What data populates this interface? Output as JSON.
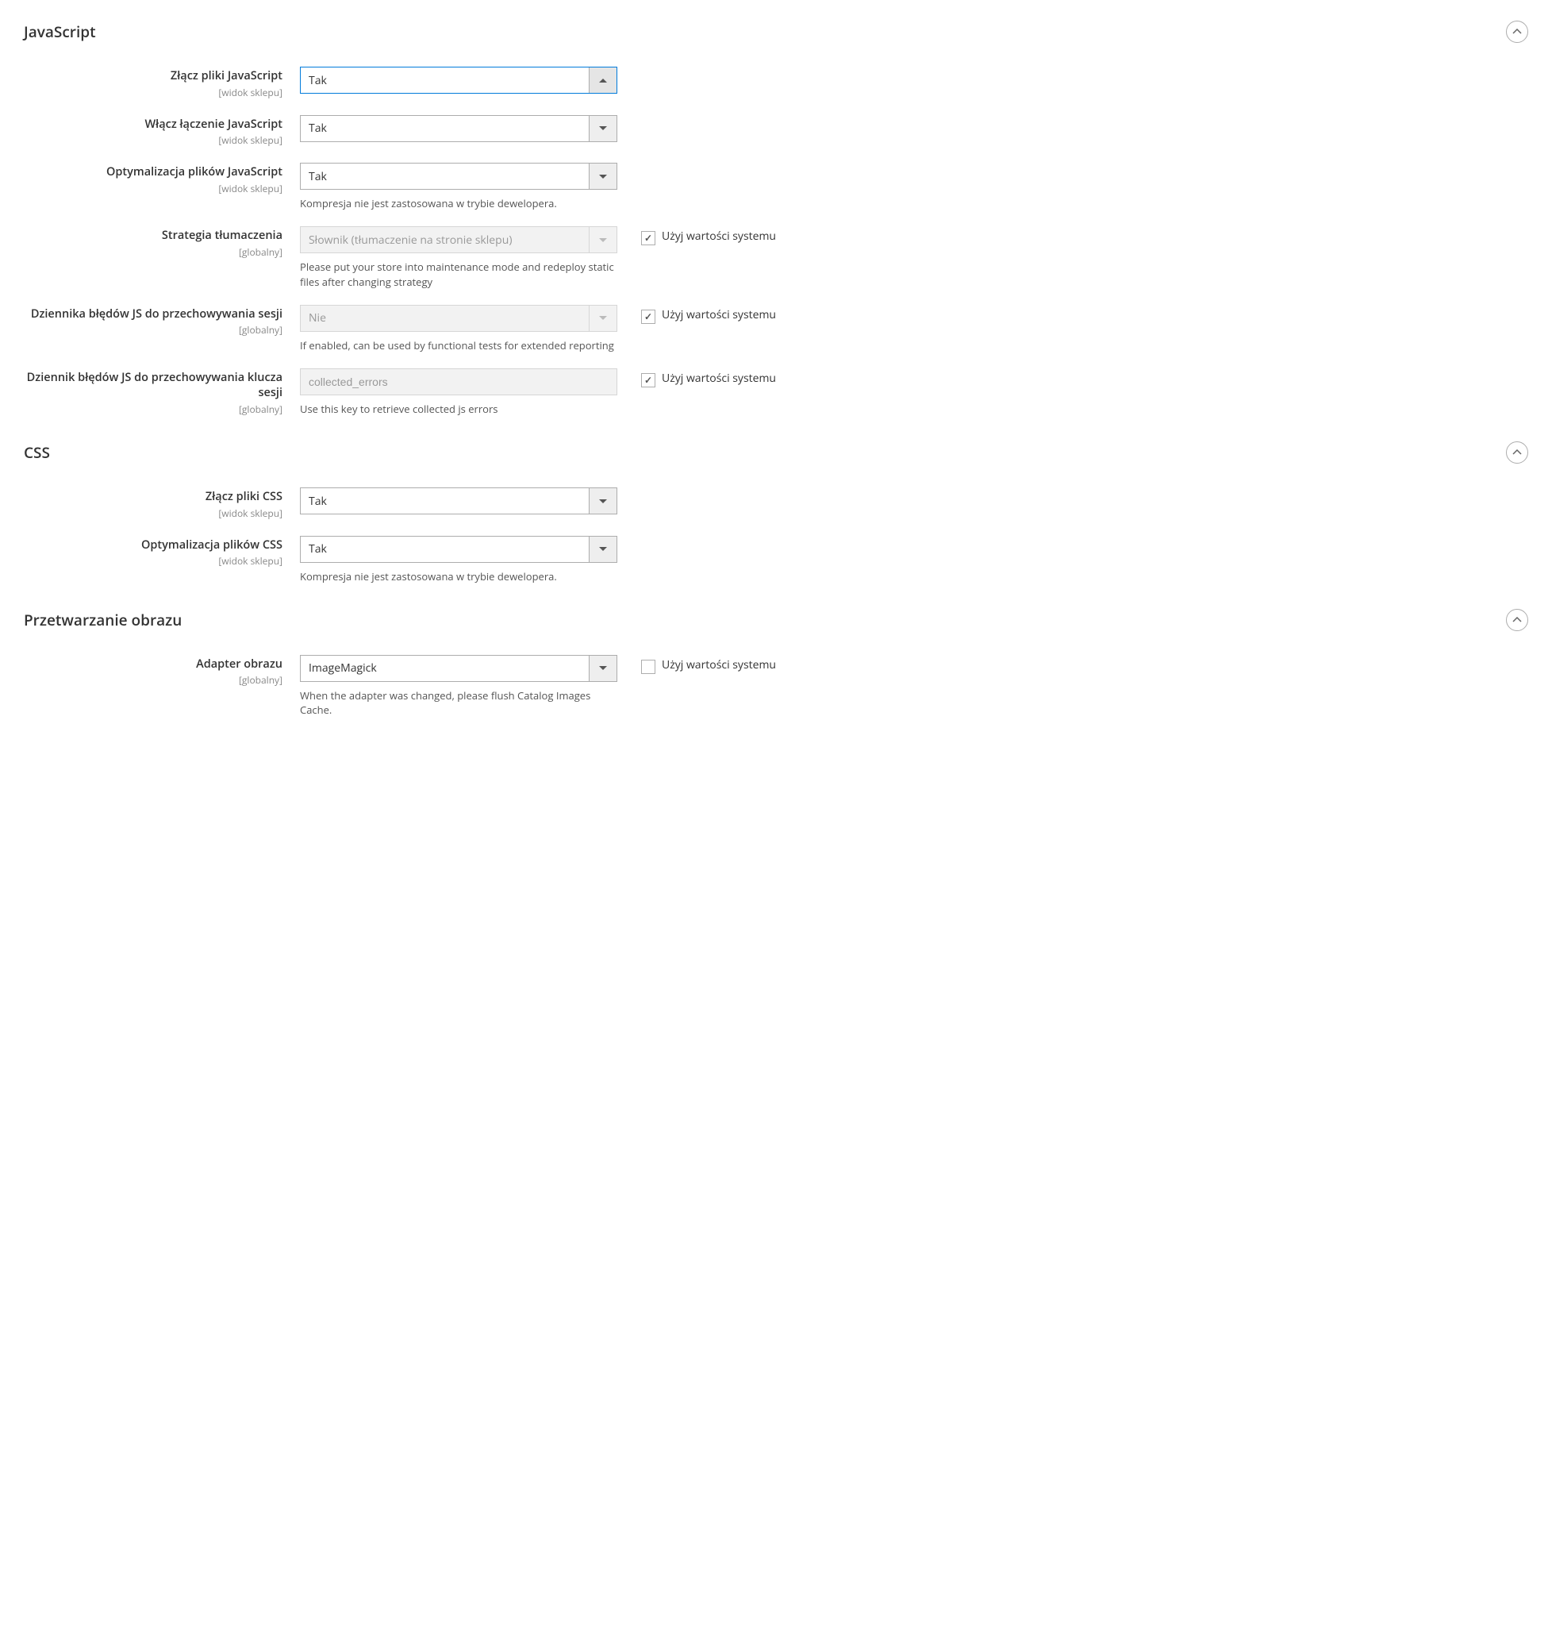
{
  "common": {
    "scope_store": "[widok sklepu]",
    "scope_global": "[globalny]",
    "use_default_label": "Użyj wartości systemu"
  },
  "js": {
    "title": "JavaScript",
    "f1": {
      "label": "Złącz pliki JavaScript",
      "value": "Tak"
    },
    "f2": {
      "label": "Włącz łączenie JavaScript",
      "value": "Tak"
    },
    "f3": {
      "label": "Optymalizacja plików JavaScript",
      "value": "Tak",
      "note": "Kompresja nie jest zastosowana w trybie dewelopera."
    },
    "f4": {
      "label": "Strategia tłumaczenia",
      "value": "Słownik (tłumaczenie na stronie sklepu)",
      "note": "Please put your store into maintenance mode and redeploy static files after changing strategy"
    },
    "f5": {
      "label": "Dziennika błędów JS do przechowywania sesji",
      "value": "Nie",
      "note": "If enabled, can be used by functional tests for extended reporting"
    },
    "f6": {
      "label": "Dziennik błędów JS do przechowywania klucza sesji",
      "value": "collected_errors",
      "note": "Use this key to retrieve collected js errors"
    }
  },
  "css": {
    "title": "CSS",
    "f1": {
      "label": "Złącz pliki CSS",
      "value": "Tak"
    },
    "f2": {
      "label": "Optymalizacja plików CSS",
      "value": "Tak",
      "note": "Kompresja nie jest zastosowana w trybie dewelopera."
    }
  },
  "img": {
    "title": "Przetwarzanie obrazu",
    "f1": {
      "label": "Adapter obrazu",
      "value": "ImageMagick",
      "note": "When the adapter was changed, please flush Catalog Images Cache."
    }
  }
}
